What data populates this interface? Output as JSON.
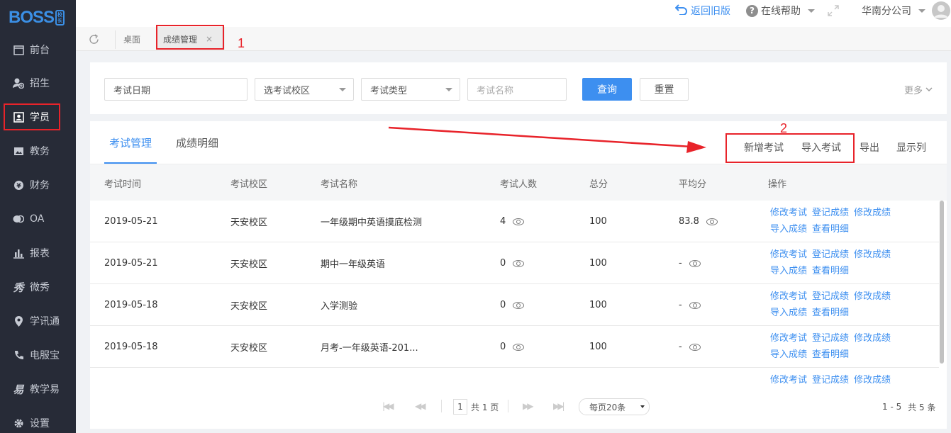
{
  "logo": {
    "text": "BOSS",
    "badge_top": "校",
    "badge_bottom": "长"
  },
  "sidebar": {
    "items": [
      {
        "label": "前台",
        "icon": "calendar-icon"
      },
      {
        "label": "招生",
        "icon": "user-add-icon"
      },
      {
        "label": "学员",
        "icon": "student-card-icon"
      },
      {
        "label": "教务",
        "icon": "image-book-icon"
      },
      {
        "label": "财务",
        "icon": "yen-coin-icon"
      },
      {
        "label": "OA",
        "icon": "chat-bubbles-icon"
      },
      {
        "label": "报表",
        "icon": "bar-chart-icon"
      },
      {
        "label": "微秀",
        "icon": "xiu-icon"
      },
      {
        "label": "学讯通",
        "icon": "location-pin-icon"
      },
      {
        "label": "电服宝",
        "icon": "phone-service-icon"
      },
      {
        "label": "教学易",
        "icon": "teach-icon"
      },
      {
        "label": "设置",
        "icon": "gear-icon"
      }
    ]
  },
  "topbar": {
    "back_old": "返回旧版",
    "help": "在线帮助",
    "branch": "华南分公司"
  },
  "tabs": {
    "desk": "桌面",
    "current": "成绩管理",
    "close": "×"
  },
  "annotations": {
    "num1": "1",
    "num2": "2"
  },
  "filters": {
    "exam_date": "考试日期",
    "campus": "选考试校区",
    "exam_type": "考试类型",
    "exam_name_placeholder": "考试名称",
    "query": "查询",
    "reset": "重置",
    "more": "更多"
  },
  "panel_tabs": [
    "考试管理",
    "成绩明细"
  ],
  "actions": {
    "add": "新增考试",
    "import": "导入考试",
    "export": "导出",
    "columns": "显示列"
  },
  "table": {
    "headers": [
      "考试时间",
      "考试校区",
      "考试名称",
      "考试人数",
      "总分",
      "平均分",
      "操作"
    ],
    "rows": [
      {
        "date": "2019-05-21",
        "campus": "天安校区",
        "name": "一年级期中英语摸底检测",
        "count": "4",
        "total": "100",
        "avg": "83.8"
      },
      {
        "date": "2019-05-21",
        "campus": "天安校区",
        "name": "期中一年级英语",
        "count": "0",
        "total": "100",
        "avg": "-"
      },
      {
        "date": "2019-05-18",
        "campus": "天安校区",
        "name": "入学测验",
        "count": "0",
        "total": "100",
        "avg": "-"
      },
      {
        "date": "2019-05-18",
        "campus": "天安校区",
        "name": "月考-一年级英语-201...",
        "count": "0",
        "total": "100",
        "avg": "-"
      },
      {
        "date": "",
        "campus": "",
        "name": "",
        "count": "",
        "total": "",
        "avg": ""
      }
    ],
    "ops_line1": [
      "修改考试",
      "登记成绩",
      "修改成绩"
    ],
    "ops_line2": [
      "导入成绩",
      "查看明细"
    ]
  },
  "pager": {
    "page": "1",
    "total_pages": "共 1 页",
    "per_page": "每页20条",
    "range": "1 - 5",
    "total": "共 5 条"
  }
}
